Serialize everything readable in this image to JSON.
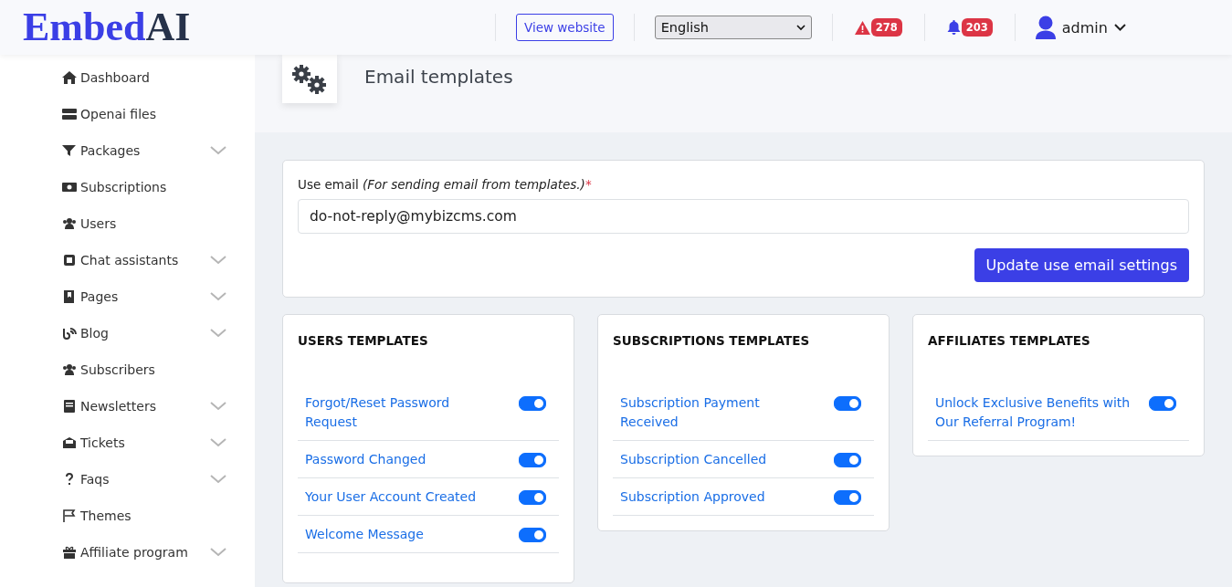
{
  "header": {
    "logo": {
      "part_1": "Embed",
      "part_2": "AI"
    },
    "view_website": "View website",
    "language": {
      "value": "English"
    },
    "alerts": {
      "count": "278"
    },
    "notifications": {
      "count": "203"
    },
    "user": {
      "name": "admin"
    }
  },
  "sidebar": {
    "items": [
      {
        "label": "Dashboard",
        "has_submenu": false
      },
      {
        "label": "Openai files",
        "has_submenu": false
      },
      {
        "label": "Packages",
        "has_submenu": true
      },
      {
        "label": "Subscriptions",
        "has_submenu": false
      },
      {
        "label": "Users",
        "has_submenu": false
      },
      {
        "label": "Chat assistants",
        "has_submenu": true
      },
      {
        "label": "Pages",
        "has_submenu": true
      },
      {
        "label": "Blog",
        "has_submenu": true
      },
      {
        "label": "Subscribers",
        "has_submenu": false
      },
      {
        "label": "Newsletters",
        "has_submenu": true
      },
      {
        "label": "Tickets",
        "has_submenu": true
      },
      {
        "label": "Faqs",
        "has_submenu": true
      },
      {
        "label": "Themes",
        "has_submenu": false
      },
      {
        "label": "Affiliate program",
        "has_submenu": true
      }
    ]
  },
  "page": {
    "title": "Email templates"
  },
  "email_settings": {
    "label": "Use email",
    "hint": "(For sending email from templates.)",
    "required_mark": "*",
    "value": "do-not-reply@mybizcms.com",
    "button": "Update use email settings"
  },
  "template_groups": [
    {
      "title": "USERS TEMPLATES",
      "templates": [
        {
          "name": "Forgot/Reset Password Request",
          "on": true
        },
        {
          "name": "Password Changed",
          "on": true
        },
        {
          "name": "Your User Account Created",
          "on": true
        },
        {
          "name": "Welcome Message",
          "on": true
        }
      ]
    },
    {
      "title": "SUBSCRIPTIONS TEMPLATES",
      "templates": [
        {
          "name": "Subscription Payment Received",
          "on": true
        },
        {
          "name": "Subscription Cancelled",
          "on": true
        },
        {
          "name": "Subscription Approved",
          "on": true
        }
      ]
    },
    {
      "title": "AFFILIATES TEMPLATES",
      "templates": [
        {
          "name": "Unlock Exclusive Benefits with Our Referral Program!",
          "on": true
        }
      ]
    }
  ]
}
